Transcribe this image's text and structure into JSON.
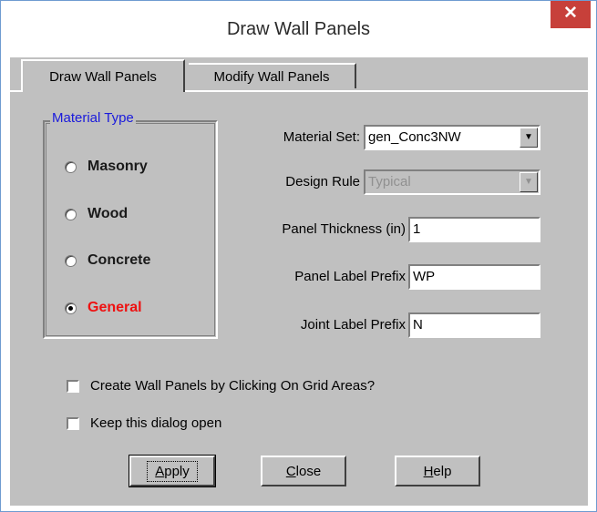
{
  "window": {
    "title": "Draw Wall Panels",
    "close_symbol": "✕"
  },
  "tabs": [
    {
      "label": "Draw Wall Panels",
      "active": true
    },
    {
      "label": "Modify Wall Panels",
      "active": false
    }
  ],
  "material_type": {
    "title": "Material Type",
    "options": [
      {
        "label": "Masonry",
        "selected": false
      },
      {
        "label": "Wood",
        "selected": false
      },
      {
        "label": "Concrete",
        "selected": false
      },
      {
        "label": "General",
        "selected": true,
        "color": "#ee1111"
      }
    ]
  },
  "form": {
    "material_set": {
      "label": "Material Set:",
      "value": "gen_Conc3NW"
    },
    "design_rule": {
      "label": "Design Rule",
      "value": "Typical",
      "disabled": true
    },
    "panel_thickness": {
      "label": "Panel Thickness (in)",
      "value": "1"
    },
    "panel_label_prefix": {
      "label": "Panel Label Prefix",
      "value": "WP"
    },
    "joint_label_prefix": {
      "label": "Joint Label Prefix",
      "value": "N"
    }
  },
  "options": {
    "grid_click": {
      "label": "Create Wall Panels by Clicking On Grid Areas?",
      "checked": false
    },
    "keep_open": {
      "label": "Keep this dialog open",
      "checked": false
    }
  },
  "buttons": {
    "apply": {
      "mnemonic": "A",
      "rest": "pply"
    },
    "close": {
      "mnemonic": "C",
      "rest": "lose"
    },
    "help": {
      "mnemonic": "H",
      "rest": "elp"
    }
  },
  "icons": {
    "dropdown": "▼",
    "close": "close-icon"
  }
}
